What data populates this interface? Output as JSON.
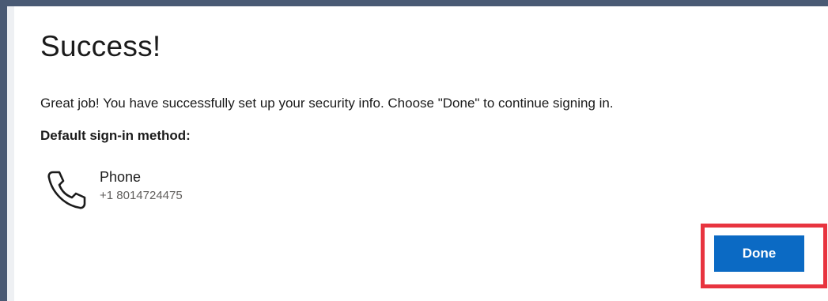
{
  "dialog": {
    "title": "Success!",
    "message": "Great job! You have successfully set up your security info. Choose \"Done\" to continue signing in.",
    "default_method_label": "Default sign-in method:"
  },
  "method": {
    "icon": "phone-icon",
    "name": "Phone",
    "value": "+1 8014724475"
  },
  "actions": {
    "done_label": "Done"
  },
  "colors": {
    "frame": "#4a5a74",
    "primary_button": "#0b6ac4",
    "highlight": "#e8343f"
  }
}
